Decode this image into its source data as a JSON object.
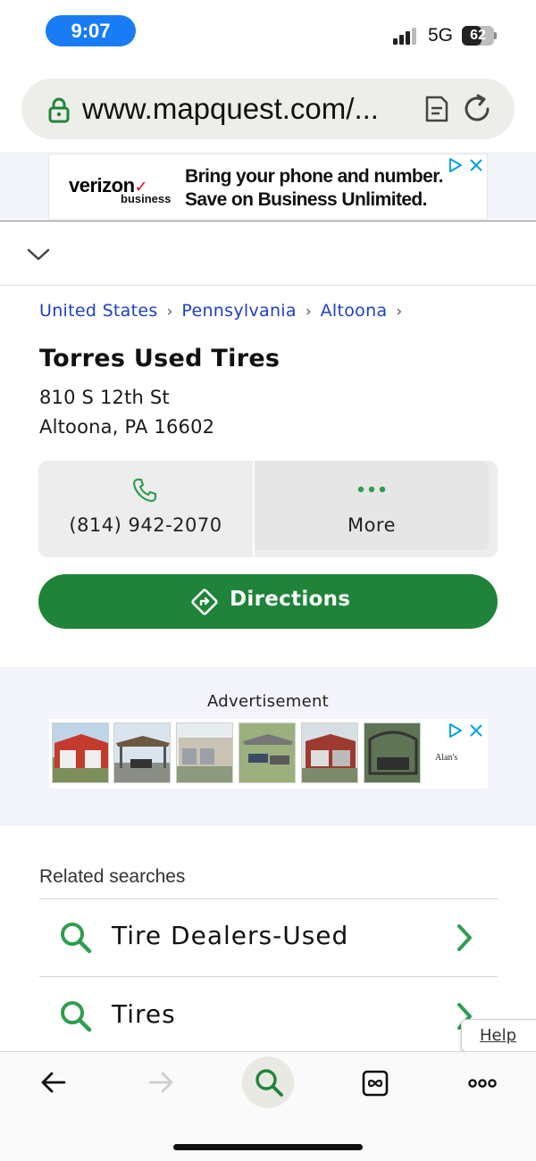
{
  "status_bar": {
    "time": "9:07",
    "network": "5G",
    "battery": "62",
    "battery_fraction": 0.62
  },
  "browser": {
    "url": "www.mapquest.com/..."
  },
  "top_ad": {
    "brand": "verizon",
    "brand_sub": "business",
    "line1": "Bring your phone and number.",
    "line2": "Save on Business Unlimited."
  },
  "breadcrumb": {
    "items": [
      "United States",
      "Pennsylvania",
      "Altoona"
    ],
    "separator": "›"
  },
  "business": {
    "name": "Torres Used Tires",
    "address_line1": "810 S 12th St",
    "address_line2": "Altoona, PA 16602",
    "phone": "(814) 942-2070",
    "more_label": "More",
    "directions_label": "Directions"
  },
  "ad_section": {
    "label": "Advertisement",
    "advertiser_logo": "Alan's"
  },
  "related": {
    "title": "Related searches",
    "items": [
      {
        "label": "Tire Dealers-Used"
      },
      {
        "label": "Tires"
      }
    ]
  },
  "help": {
    "label": "Help"
  },
  "colors": {
    "accent_green": "#1f8439",
    "link_blue": "#1d3fc4",
    "time_pill": "#1a7cf5"
  },
  "toolbar": {
    "icons": [
      "back-arrow-icon",
      "forward-arrow-icon",
      "search-icon",
      "tabs-icon",
      "more-icon"
    ]
  }
}
